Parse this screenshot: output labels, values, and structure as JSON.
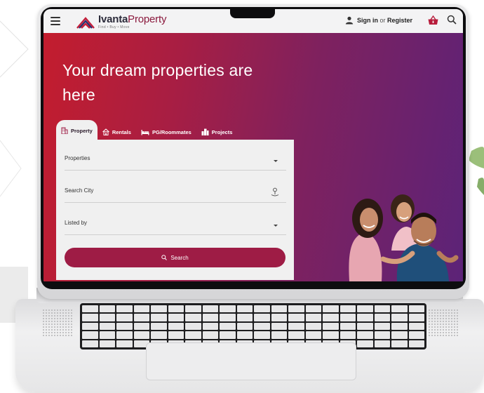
{
  "header": {
    "brand_name": "Ivanta",
    "brand_suffix": "Property",
    "tagline": "Find • Buy • Move",
    "sign_in_label": "Sign in",
    "or_label": "or",
    "register_label": "Register"
  },
  "hero": {
    "title": "Your dream properties are here"
  },
  "tabs": [
    {
      "label": "Property",
      "icon": "building-icon",
      "active": true
    },
    {
      "label": "Rentals",
      "icon": "house-icon",
      "active": false
    },
    {
      "label": "PG/Roommates",
      "icon": "bed-icon",
      "active": false
    },
    {
      "label": "Projects",
      "icon": "city-icon",
      "active": false
    }
  ],
  "search_form": {
    "property_type_label": "Properties",
    "city_label": "Search City",
    "listed_by_label": "Listed by",
    "search_button_label": "Search"
  },
  "colors": {
    "brand": "#9e1c45",
    "hero_start": "#c31d2e",
    "hero_end": "#5c2378"
  }
}
